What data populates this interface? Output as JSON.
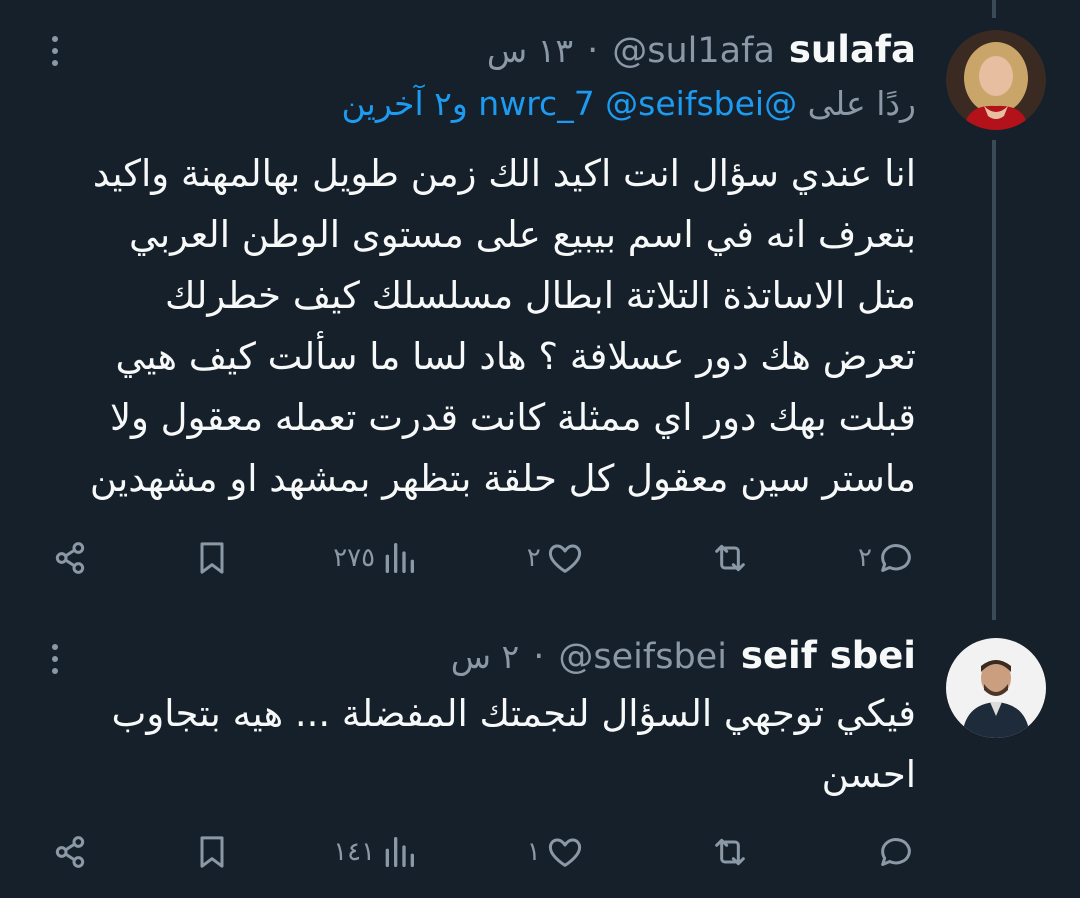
{
  "colors": {
    "background": "#15202b",
    "text": "#f7f9f9",
    "muted": "#8b98a5",
    "link": "#1d9bf0",
    "thread_line": "#3b4a57"
  },
  "tweets": [
    {
      "display_name": "sulafa",
      "handle": "@sul1afa",
      "time": "١٣ س",
      "separator": "·",
      "reply_prefix": "ردًا على",
      "reply_mentions": "@nwrc_7 @seifsbei",
      "reply_others": "و٢ آخرين",
      "lines": [
        "انا عندي سؤال انت اكيد الك زمن طويل بهالمهنة واكيد",
        "بتعرف انه في اسم بيبيع على مستوى الوطن العربي",
        "متل الاساتذة التلاتة ابطال مسلسلك كيف خطرلك",
        "تعرض هك دور عسلافة ؟ هاد لسا ما سألت كيف هيي",
        "قبلت بهك دور اي ممثلة كانت قدرت تعمله معقول ولا",
        "ماستر سين معقول كل حلقة بتظهر بمشهد او مشهدين"
      ],
      "actions": {
        "replies": "٢",
        "retweets": "",
        "likes": "٢",
        "views": "٢٧٥"
      },
      "icons": [
        "reply-icon",
        "retweet-icon",
        "like-icon",
        "views-icon",
        "bookmark-icon",
        "share-icon",
        "more-icon"
      ]
    },
    {
      "display_name": "seif sbei",
      "handle": "@seifsbei",
      "time": "٢ س",
      "separator": "·",
      "lines": [
        "فيكي توجهي السؤال لنجمتك المفضلة ... هيه بتجاوب",
        "احسن"
      ],
      "actions": {
        "replies": "",
        "retweets": "",
        "likes": "١",
        "views": "١٤١"
      },
      "icons": [
        "reply-icon",
        "retweet-icon",
        "like-icon",
        "views-icon",
        "bookmark-icon",
        "share-icon",
        "more-icon"
      ]
    }
  ]
}
